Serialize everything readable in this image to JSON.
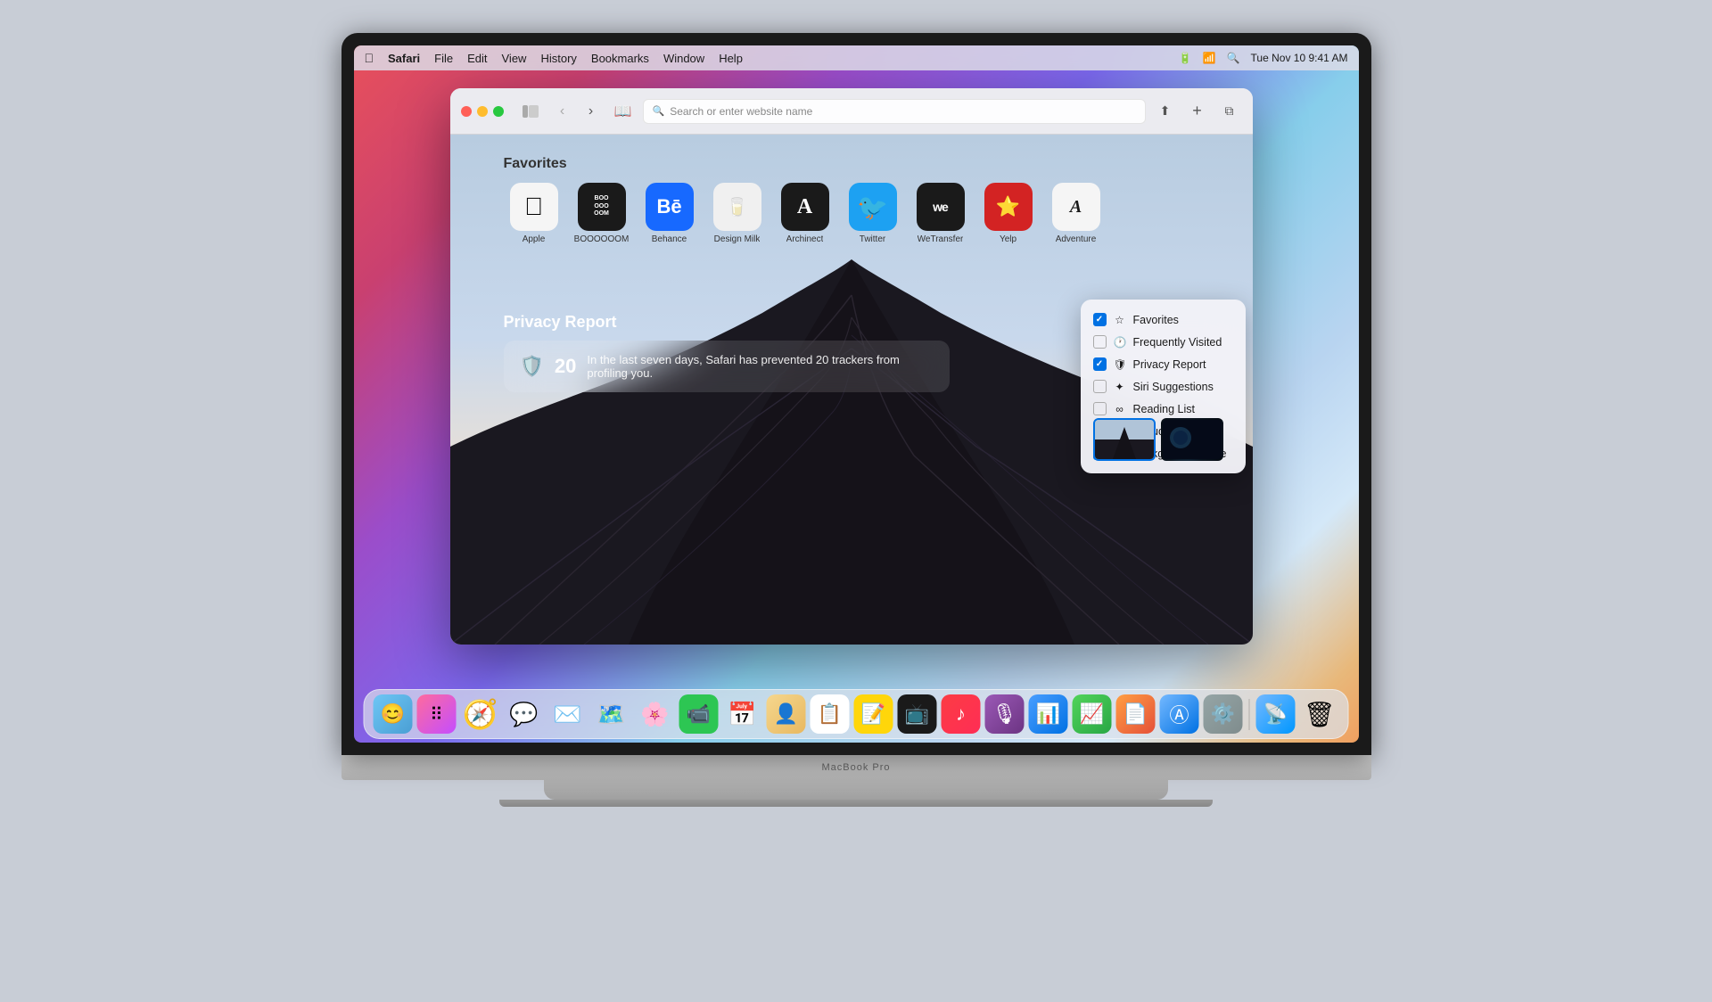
{
  "menubar": {
    "apple_logo": "🍎",
    "app_name": "Safari",
    "menus": [
      "File",
      "Edit",
      "View",
      "History",
      "Bookmarks",
      "Window",
      "Help"
    ],
    "time": "Tue Nov 10  9:41 AM"
  },
  "safari": {
    "toolbar": {
      "address_placeholder": "Search or enter website name",
      "new_tab_label": "+",
      "share_label": "⬆",
      "tabs_label": "⧉"
    },
    "new_tab": {
      "favorites_title": "Favorites",
      "privacy_title": "Privacy Report",
      "privacy_count": "20",
      "privacy_message": "In the last seven days, Safari has prevented 20 trackers from profiling you.",
      "favorites": [
        {
          "label": "Apple",
          "icon": ""
        },
        {
          "label": "BOOOOOOM",
          "icon": "BOO\nOOO\nOOM"
        },
        {
          "label": "Behance",
          "icon": "Bē"
        },
        {
          "label": "Design Milk",
          "icon": "🥛"
        },
        {
          "label": "Archinect",
          "icon": "A"
        },
        {
          "label": "Twitter",
          "icon": "🐦"
        },
        {
          "label": "WeTransfer",
          "icon": "we"
        },
        {
          "label": "Yelp",
          "icon": ""
        },
        {
          "label": "Adventure",
          "icon": "A"
        }
      ]
    }
  },
  "customize_popup": {
    "items": [
      {
        "label": "Favorites",
        "checked": true,
        "icon": "☆"
      },
      {
        "label": "Frequently Visited",
        "checked": false,
        "icon": "🕐"
      },
      {
        "label": "Privacy Report",
        "checked": true,
        "icon": "🛡"
      },
      {
        "label": "Siri Suggestions",
        "checked": false,
        "icon": "🔮"
      },
      {
        "label": "Reading List",
        "checked": false,
        "icon": "∞"
      },
      {
        "label": "iCloud Tabs",
        "checked": false,
        "icon": "☁"
      },
      {
        "label": "Background Image",
        "checked": true,
        "icon": "🖼"
      }
    ]
  },
  "dock": {
    "items": [
      {
        "name": "finder",
        "icon": "🔵",
        "label": "Finder"
      },
      {
        "name": "launchpad",
        "icon": "⬛",
        "label": "Launchpad"
      },
      {
        "name": "safari",
        "icon": "🧭",
        "label": "Safari"
      },
      {
        "name": "messages",
        "icon": "💬",
        "label": "Messages"
      },
      {
        "name": "mail",
        "icon": "✉️",
        "label": "Mail"
      },
      {
        "name": "maps",
        "icon": "🗺",
        "label": "Maps"
      },
      {
        "name": "photos",
        "icon": "🌅",
        "label": "Photos"
      },
      {
        "name": "facetime",
        "icon": "📷",
        "label": "FaceTime"
      },
      {
        "name": "calendar",
        "icon": "📅",
        "label": "Calendar"
      },
      {
        "name": "contacts",
        "icon": "👤",
        "label": "Contacts"
      },
      {
        "name": "reminders",
        "icon": "📋",
        "label": "Reminders"
      },
      {
        "name": "notes",
        "icon": "📝",
        "label": "Notes"
      },
      {
        "name": "tv",
        "icon": "📺",
        "label": "TV"
      },
      {
        "name": "music",
        "icon": "🎵",
        "label": "Music"
      },
      {
        "name": "podcasts",
        "icon": "🎙",
        "label": "Podcasts"
      },
      {
        "name": "keynote",
        "icon": "📊",
        "label": "Keynote"
      },
      {
        "name": "numbers",
        "icon": "📈",
        "label": "Numbers"
      },
      {
        "name": "pages",
        "icon": "📄",
        "label": "Pages"
      },
      {
        "name": "appstore",
        "icon": "🅰",
        "label": "App Store"
      },
      {
        "name": "preferences",
        "icon": "⚙️",
        "label": "System Preferences"
      },
      {
        "name": "airdrop",
        "icon": "📡",
        "label": "AirDrop"
      },
      {
        "name": "trash",
        "icon": "🗑",
        "label": "Trash"
      }
    ]
  },
  "macbook_label": "MacBook Pro"
}
